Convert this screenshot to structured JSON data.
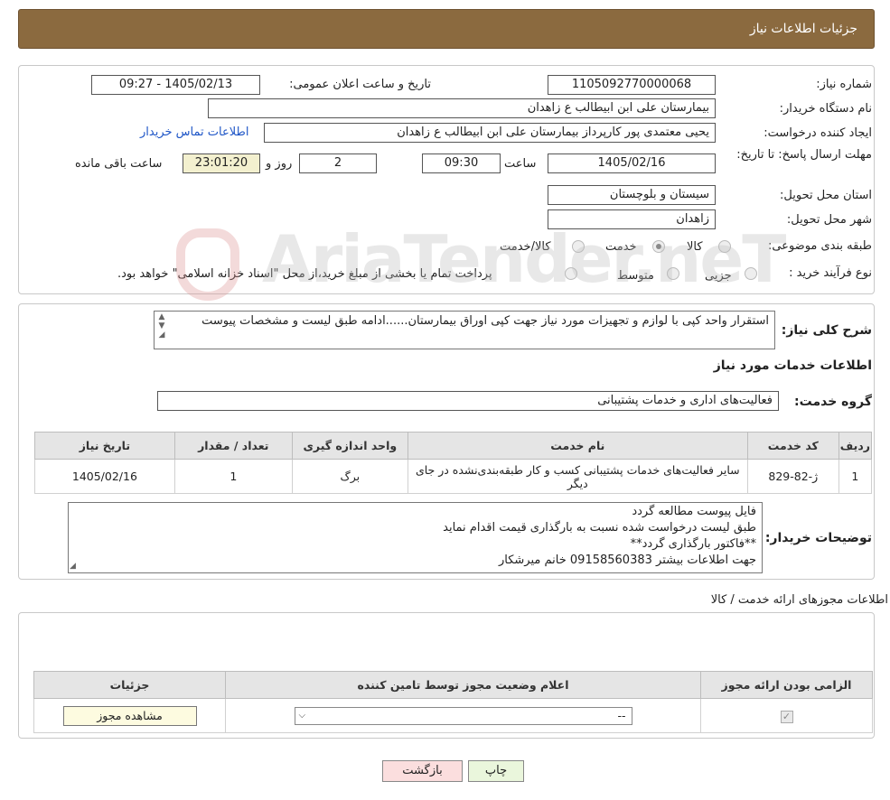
{
  "header": {
    "title": "جزئیات اطلاعات نیاز"
  },
  "form": {
    "need_number_label": "شماره نیاز:",
    "need_number": "1105092770000068",
    "announce_label": "تاریخ و ساعت اعلان عمومی:",
    "announce_value": "1405/02/13 - 09:27",
    "buyer_org_label": "نام دستگاه خریدار:",
    "buyer_org": "بیمارستان علی ابن ابیطالب  ع  زاهدان",
    "creator_label": "ایجاد کننده درخواست:",
    "creator": "یحیی معتمدی پور کارپرداز بیمارستان علی ابن ابیطالب  ع  زاهدان",
    "contact_link": "اطلاعات تماس خریدار",
    "deadline_label": "مهلت ارسال پاسخ: تا تاریخ:",
    "deadline_date": "1405/02/16",
    "time_label": "ساعت",
    "deadline_time": "09:30",
    "days_value": "2",
    "days_label": "روز و",
    "remaining_time": "23:01:20",
    "remaining_label": "ساعت باقی مانده",
    "province_label": "استان محل تحویل:",
    "province": "سیستان و بلوچستان",
    "city_label": "شهر محل تحویل:",
    "city": "زاهدان",
    "category_label": "طبقه بندی موضوعی:",
    "category_options": [
      "کالا",
      "خدمت",
      "کالا/خدمت"
    ],
    "category_selected": "خدمت",
    "process_label": "نوع فرآیند خرید :",
    "process_options": [
      "جزیی",
      "متوسط"
    ],
    "process_note": "پرداخت تمام یا بخشی از مبلغ خرید،از محل \"اسناد خزانه اسلامی\" خواهد بود."
  },
  "summary": {
    "label": "شرح کلی نیاز:",
    "text": "استقرار واحد کپی با لوازم و تجهیزات مورد نیاز جهت کپی اوراق بیمارستان......ادامه طبق لیست و مشخصات پیوست"
  },
  "services": {
    "section_title": "اطلاعات خدمات مورد نیاز",
    "group_label": "گروه خدمت:",
    "group_value": "فعالیت‌های اداری و خدمات پشتیبانی",
    "columns": [
      "ردیف",
      "کد خدمت",
      "نام خدمت",
      "واحد اندازه گیری",
      "تعداد / مقدار",
      "تاریخ نیاز"
    ],
    "rows": [
      {
        "row": "1",
        "code": "ژ-82-829",
        "name": "سایر فعالیت‌های خدمات پشتیبانی کسب و کار طبقه‌بندی‌نشده در جای دیگر",
        "unit": "برگ",
        "qty": "1",
        "date": "1405/02/16"
      }
    ]
  },
  "buyer_notes": {
    "label": "توضیحات خریدار:",
    "lines": [
      "فایل پیوست مطالعه گردد",
      "طبق لیست درخواست شده نسبت به بارگذاری قیمت اقدام نماید",
      "**فاکتور بارگذاری گردد**",
      "جهت اطلاعات بیشتر 09158560383 خانم میرشکار"
    ]
  },
  "licenses": {
    "section_title": "اطلاعات مجوزهای ارائه خدمت / کالا",
    "columns": [
      "الزامی بودن ارائه مجوز",
      "اعلام وضعیت مجوز توسط تامین کننده",
      "جزئیات"
    ],
    "select_value": "--",
    "view_button": "مشاهده مجوز"
  },
  "buttons": {
    "print": "چاپ",
    "back": "بازگشت"
  },
  "watermark": {
    "text": "AriaTender.neT"
  }
}
